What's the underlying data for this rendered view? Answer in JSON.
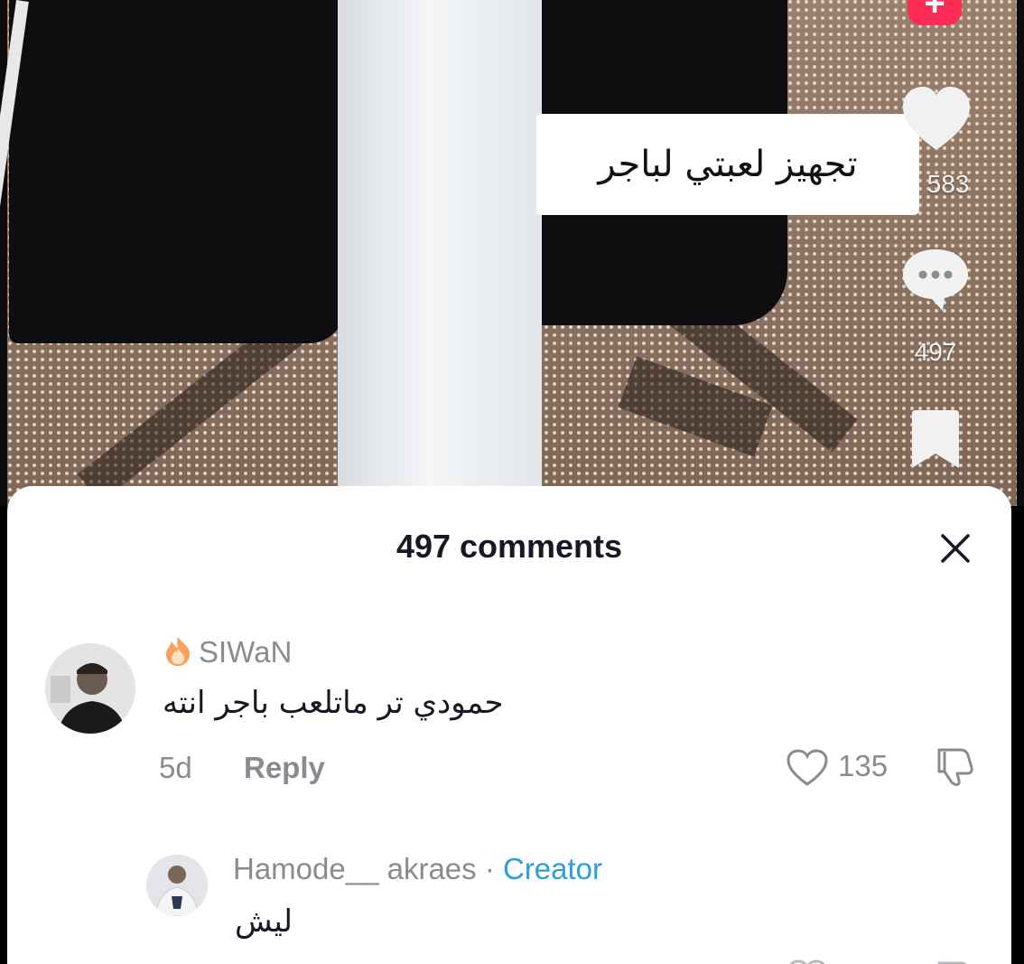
{
  "video": {
    "caption": "تجهيز لعبتي لباجر",
    "rail": {
      "likes_count": "583",
      "comments_count": "497"
    }
  },
  "sheet": {
    "title": "497 comments",
    "comments": [
      {
        "username": "SIWaN",
        "text": "حمودي تر ماتلعب باجر انته",
        "age": "5d",
        "reply_label": "Reply",
        "like_count": "135"
      },
      {
        "username": "Hamode__ akraes",
        "separator": " · ",
        "badge": "Creator",
        "text": "ليش"
      }
    ]
  },
  "colors": {
    "accent_pink": "#fe2c55",
    "creator_blue": "#2a9fd8",
    "muted_gray": "#8a8b91",
    "text_dark": "#161823"
  }
}
